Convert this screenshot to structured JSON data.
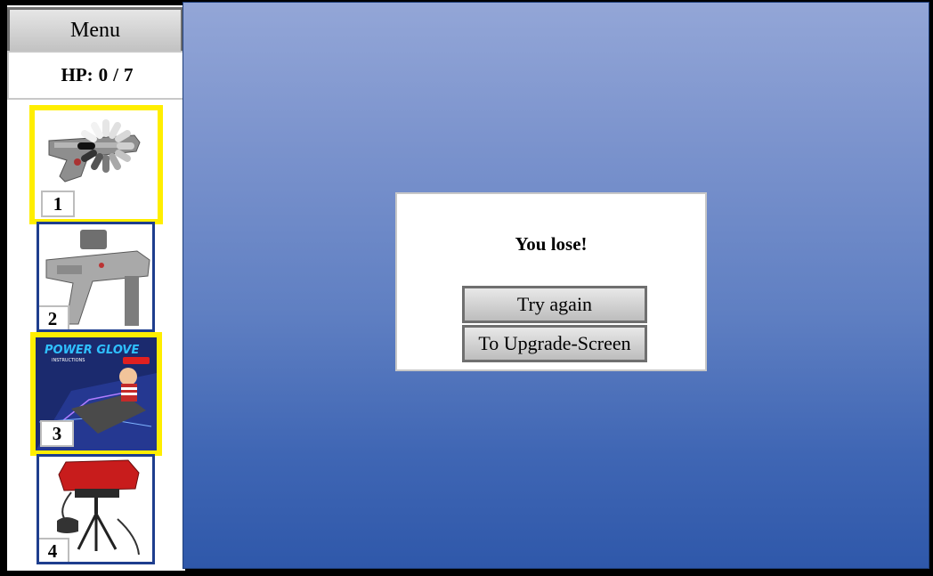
{
  "menu": {
    "label": "Menu"
  },
  "hp": {
    "label": "HP:",
    "current": "0",
    "separator": "/",
    "max": "7"
  },
  "slots": [
    {
      "number": "1",
      "item": "light-gun",
      "selected": true,
      "loading": true
    },
    {
      "number": "2",
      "item": "super-scope",
      "selected": false
    },
    {
      "number": "3",
      "item": "power-glove",
      "selected": true,
      "box_title": "POWER GLOVE",
      "box_subtitle": "INSTRUCTIONS"
    },
    {
      "number": "4",
      "item": "virtual-boy",
      "selected": false
    }
  ],
  "dialog": {
    "message": "You lose!",
    "try_again_label": "Try again",
    "upgrade_label": "To Upgrade-Screen"
  },
  "colors": {
    "selected_border": "#ffee00",
    "unselected_border": "#1e3e8e",
    "game_gradient_top": "#93a6d7",
    "game_gradient_bottom": "#2f58aa"
  }
}
